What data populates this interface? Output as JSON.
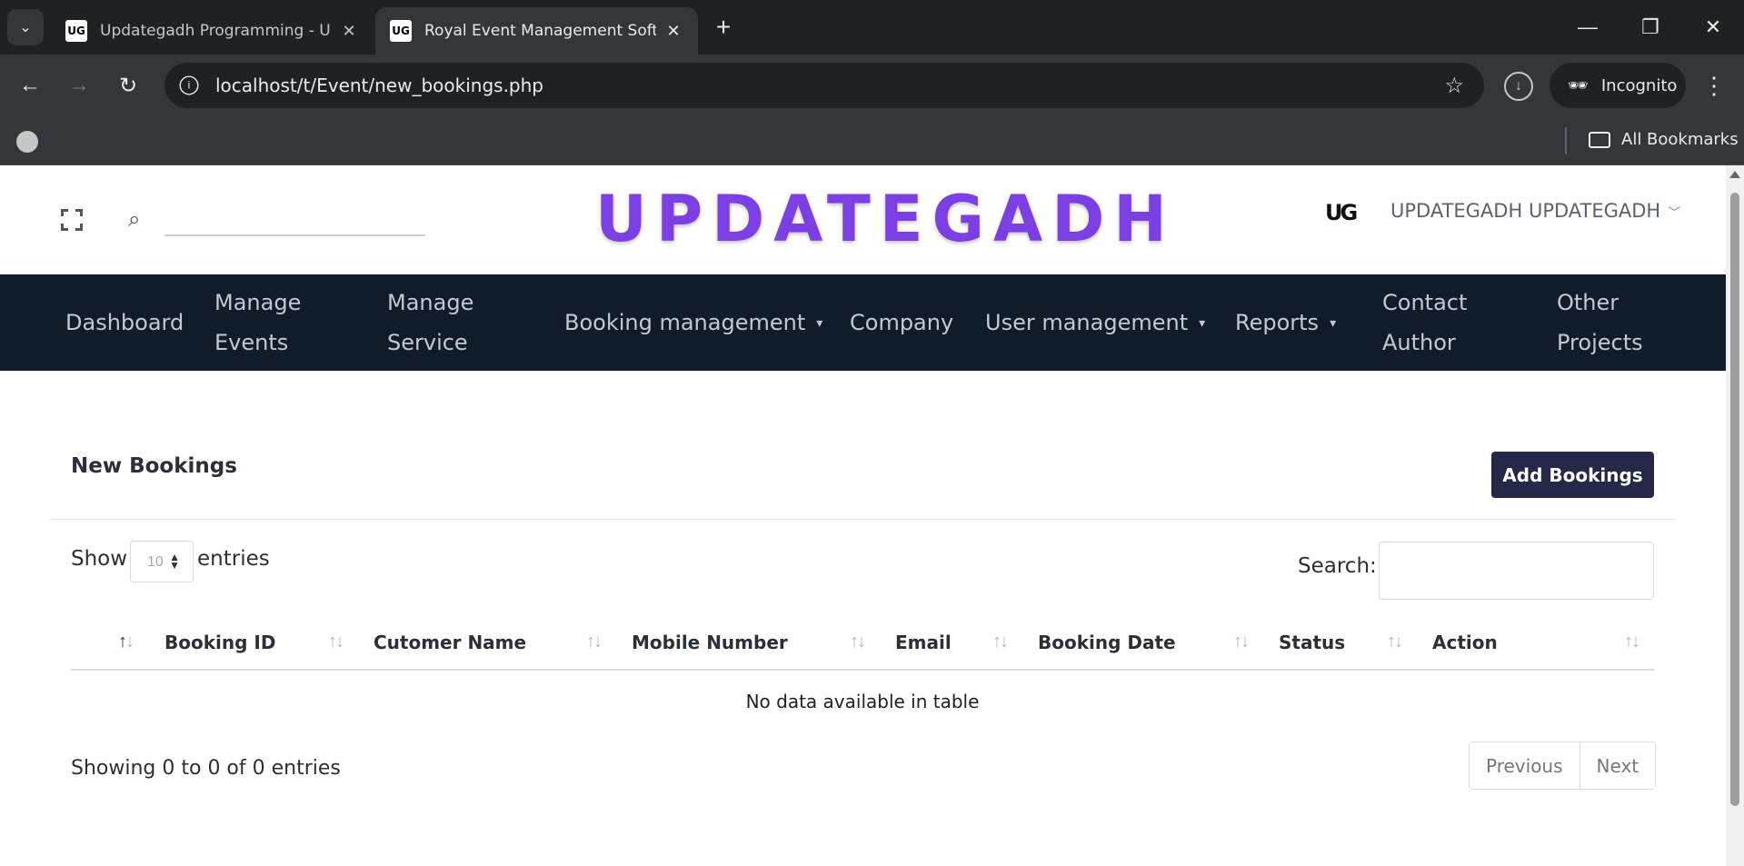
{
  "browser": {
    "tabs": [
      {
        "title": "Updategadh Programming - Up",
        "favicon": "UG",
        "active": false
      },
      {
        "title": "Royal Event Management Softw",
        "favicon": "UG",
        "active": true
      }
    ],
    "url": "localhost/t/Event/new_bookings.php",
    "incognito_label": "Incognito",
    "all_bookmarks_label": "All Bookmarks"
  },
  "header": {
    "brand": "UPDATEGADH",
    "search_placeholder": "",
    "avatar_text": "UG",
    "username": "UPDATEGADH UPDATEGADH"
  },
  "nav": {
    "dashboard": "Dashboard",
    "manage_events_1": "Manage",
    "manage_events_2": "Events",
    "manage_service_1": "Manage",
    "manage_service_2": "Service",
    "booking_management": "Booking management",
    "company": "Company",
    "user_management": "User management",
    "reports": "Reports",
    "contact_author_1": "Contact",
    "contact_author_2": "Author",
    "other_projects_1": "Other",
    "other_projects_2": "Projects"
  },
  "card": {
    "title": "New Bookings",
    "add_button": "Add Bookings"
  },
  "table_controls": {
    "show_label": "Show",
    "entries_value": "10",
    "entries_label": "entries",
    "search_label": "Search:",
    "search_value": ""
  },
  "table": {
    "columns": [
      "Booking ID",
      "Cutomer Name",
      "Mobile Number",
      "Email",
      "Booking Date",
      "Status",
      "Action"
    ],
    "empty_message": "No data available in table",
    "info": "Showing 0 to 0 of 0 entries",
    "previous": "Previous",
    "next": "Next"
  },
  "colors": {
    "brand": "#7b3fe4",
    "nav_bg": "#111c2b",
    "button_bg": "#252848"
  }
}
